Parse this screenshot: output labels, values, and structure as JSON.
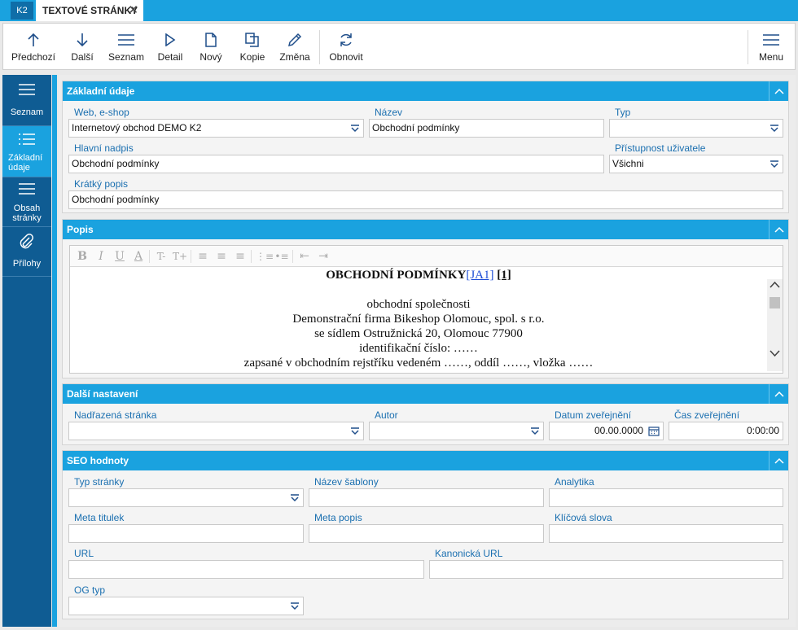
{
  "tabs": {
    "k2": "K2",
    "active": "TEXTOVÉ STRÁNKY"
  },
  "toolbar": {
    "prev": "Předchozí",
    "next": "Další",
    "list": "Seznam",
    "detail": "Detail",
    "new": "Nový",
    "copy": "Kopie",
    "change": "Změna",
    "refresh": "Obnovit",
    "menu": "Menu"
  },
  "sidebar": {
    "items": [
      {
        "label": "Seznam",
        "icon": "list-icon"
      },
      {
        "label": "Základní údaje",
        "icon": "list-bullets-icon",
        "active": true
      },
      {
        "label": "Obsah stránky",
        "icon": "list-icon"
      },
      {
        "label": "Přílohy",
        "icon": "paperclip-icon"
      }
    ]
  },
  "sections": {
    "basic": {
      "title": "Základní údaje",
      "web_label": "Web, e-shop",
      "web_value": "Internetový obchod DEMO K2",
      "name_label": "Název",
      "name_value": "Obchodní podmínky",
      "type_label": "Typ",
      "type_value": "",
      "heading_label": "Hlavní nadpis",
      "heading_value": "Obchodní podmínky",
      "access_label": "Přístupnost uživatele",
      "access_value": "Všichni",
      "short_label": "Krátký popis",
      "short_value": "Obchodní podmínky"
    },
    "desc": {
      "title": "Popis",
      "toolbar_glyphs": [
        "B",
        "I",
        "U",
        "A",
        "T-",
        "T+",
        "≡",
        "≡",
        "≡",
        "⋮≡",
        "•≡",
        "⇤",
        "⇥"
      ],
      "heading": "OBCHODNÍ PODMÍNKY",
      "heading_link": "[JA1]",
      "heading_ref": "[1]",
      "lines": [
        "obchodní společnosti",
        "Demonstrační firma Bikeshop Olomouc, spol. s r.o.",
        "se sídlem Ostružnická 20, Olomouc 77900",
        "identifikační číslo: ……",
        "zapsané v obchodním rejstříku vedeném ……, oddíl ……, vložka ……"
      ]
    },
    "more": {
      "title": "Další nastavení",
      "parent_label": "Nadřazená stránka",
      "parent_value": "",
      "author_label": "Autor",
      "author_value": "",
      "date_label": "Datum zveřejnění",
      "date_value": "00.00.0000",
      "time_label": "Čas zveřejnění",
      "time_value": "0:00:00"
    },
    "seo": {
      "title": "SEO hodnoty",
      "page_type_label": "Typ stránky",
      "page_type_value": "",
      "template_label": "Název šablony",
      "template_value": "",
      "analytics_label": "Analytika",
      "analytics_value": "",
      "meta_title_label": "Meta titulek",
      "meta_title_value": "",
      "meta_desc_label": "Meta popis",
      "meta_desc_value": "",
      "keywords_label": "Klíčová slova",
      "keywords_value": "",
      "url_label": "URL",
      "url_value": "",
      "canonical_label": "Kanonická URL",
      "canonical_value": "",
      "og_label": "OG typ",
      "og_value": ""
    }
  },
  "colors": {
    "accent": "#1aa2df",
    "sidebar": "#0f5c93",
    "label": "#1a6fb0"
  }
}
